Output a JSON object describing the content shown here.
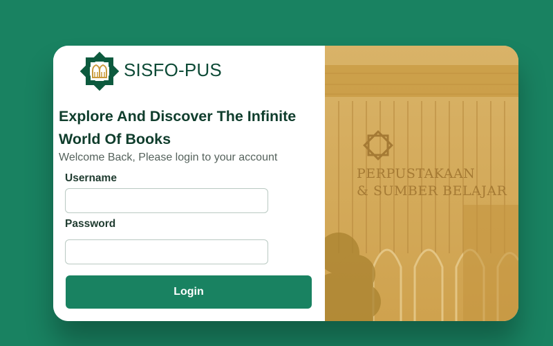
{
  "brand": {
    "name": "SISFO-PUS"
  },
  "login": {
    "headline": "Explore And Discover The Infinite World Of Books",
    "subtitle": "Welcome Back, Please login to your account",
    "username_label": "Username",
    "username_value": "",
    "password_label": "Password",
    "password_value": "",
    "button_label": "Login"
  },
  "image": {
    "building_sign_line1": "PERPUSTAKAAN",
    "building_sign_line2": "& SUMBER BELAJAR"
  },
  "colors": {
    "background": "#198261",
    "primary": "#198261",
    "heading": "#0f3d2c",
    "photo_tint": "#d4a955"
  },
  "icons": {
    "logo": "octagram-library-logo-icon"
  }
}
